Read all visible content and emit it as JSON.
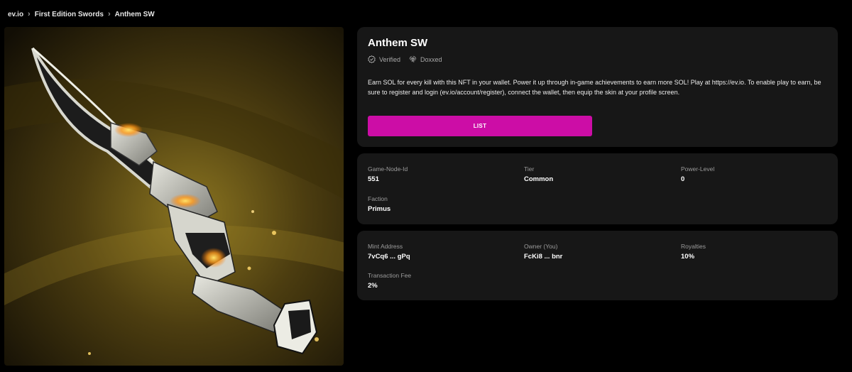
{
  "breadcrumb": {
    "items": [
      "ev.io",
      "First Edition Swords",
      "Anthem SW"
    ],
    "separator": "›"
  },
  "item": {
    "title": "Anthem SW",
    "badges": [
      {
        "label": "Verified",
        "icon": "verified-check-icon"
      },
      {
        "label": "Doxxed",
        "icon": "fingerprint-icon"
      }
    ],
    "description": "Earn SOL for every kill with this NFT in your wallet. Power it up through in-game achievements to earn more SOL! Play at https://ev.io. To enable play to earn, be sure to register and login (ev.io/account/register), connect the wallet, then equip the skin at your profile screen.",
    "list_button": "LIST",
    "image": "anthem-sword-artwork"
  },
  "attributes": [
    {
      "label": "Game-Node-Id",
      "value": "551"
    },
    {
      "label": "Tier",
      "value": "Common"
    },
    {
      "label": "Power-Level",
      "value": "0"
    },
    {
      "label": "Faction",
      "value": "Primus"
    }
  ],
  "details": [
    {
      "label": "Mint Address",
      "value": "7vCq6 ... gPq"
    },
    {
      "label": "Owner (You)",
      "value": "FcKi8 ... bnr"
    },
    {
      "label": "Royalties",
      "value": "10%"
    },
    {
      "label": "Transaction Fee",
      "value": "2%"
    }
  ],
  "colors": {
    "accent": "#cc0da6",
    "card": "#171717",
    "background": "#000000"
  }
}
